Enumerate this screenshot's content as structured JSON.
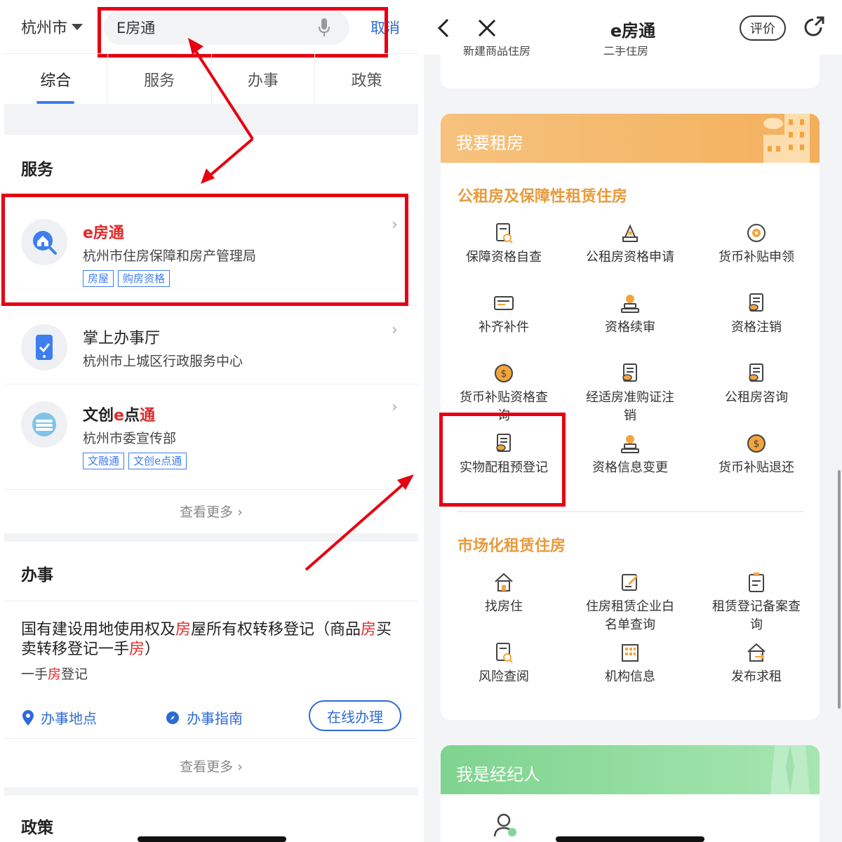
{
  "left": {
    "city": "杭州市",
    "search_value": "E房通",
    "cancel": "取消",
    "tabs": [
      "综合",
      "服务",
      "办事",
      "政策"
    ],
    "services_heading": "服务",
    "services": [
      {
        "title_prefix": "e",
        "title_rest": "房通",
        "org": "杭州市住房保障和房产管理局",
        "tags": [
          "房屋",
          "购房资格"
        ]
      },
      {
        "title": "掌上办事厅",
        "org": "杭州市上城区行政服务中心"
      },
      {
        "title_a": "文创",
        "title_b": "e",
        "title_c": "点",
        "title_d": "通",
        "org": "杭州市委宣传部",
        "tags": [
          "文融通",
          "文创e点通"
        ]
      }
    ],
    "more1": "查看更多 ›",
    "affairs_heading": "办事",
    "affair": {
      "t1": "国有建设用地使用权及",
      "t2": "房",
      "t3": "屋所有权转移登记（商品",
      "t4": "房",
      "t5": "买卖转移登记一手",
      "t6": "房",
      "t7": "）",
      "s1": "一手",
      "s2": "房",
      "s3": "登记",
      "loc": "办事地点",
      "guide": "办事指南",
      "online": "在线办理"
    },
    "more2": "查看更多 ›",
    "policy_heading": "政策"
  },
  "right": {
    "title": "e房通",
    "rate": "评价",
    "prev_items": [
      "新建商品住房",
      "二手住房"
    ],
    "rent_header": "我要租房",
    "public_heading": "公租房及保障性租赁住房",
    "public_items": [
      {
        "label": "保障资格自查",
        "icon": "doc-search-icon"
      },
      {
        "label": "公租房资格申请",
        "icon": "star-stamp-icon"
      },
      {
        "label": "货币补贴申领",
        "icon": "coin-icon"
      },
      {
        "label": "补齐补件",
        "icon": "id-card-icon"
      },
      {
        "label": "资格续审",
        "icon": "person-stamp-icon"
      },
      {
        "label": "资格注销",
        "icon": "cert-icon"
      },
      {
        "label": "货币补贴资格查询",
        "icon": "dollar-coin-icon"
      },
      {
        "label": "经适房准购证注销",
        "icon": "cert-icon"
      },
      {
        "label": "公租房咨询",
        "icon": "cert-icon"
      },
      {
        "label": "实物配租预登记",
        "icon": "cert-icon"
      },
      {
        "label": "资格信息变更",
        "icon": "person-stamp-icon"
      },
      {
        "label": "货币补贴退还",
        "icon": "dollar-coin-icon"
      }
    ],
    "market_heading": "市场化租赁住房",
    "market_items": [
      {
        "label": "找房住",
        "icon": "house-icon"
      },
      {
        "label": "住房租赁企业白名单查询",
        "icon": "edit-doc-icon"
      },
      {
        "label": "租赁登记备案查询",
        "icon": "clipboard-icon"
      },
      {
        "label": "风险查阅",
        "icon": "doc-search-icon"
      },
      {
        "label": "机构信息",
        "icon": "building-icon"
      },
      {
        "label": "发布求租",
        "icon": "house-arrow-icon"
      }
    ],
    "agent_header": "我是经纪人"
  },
  "colors": {
    "accent_blue": "#3d7ef0",
    "highlight_red": "#e60012",
    "rent_orange": "#f5b96a",
    "agent_green": "#7ed89a"
  }
}
